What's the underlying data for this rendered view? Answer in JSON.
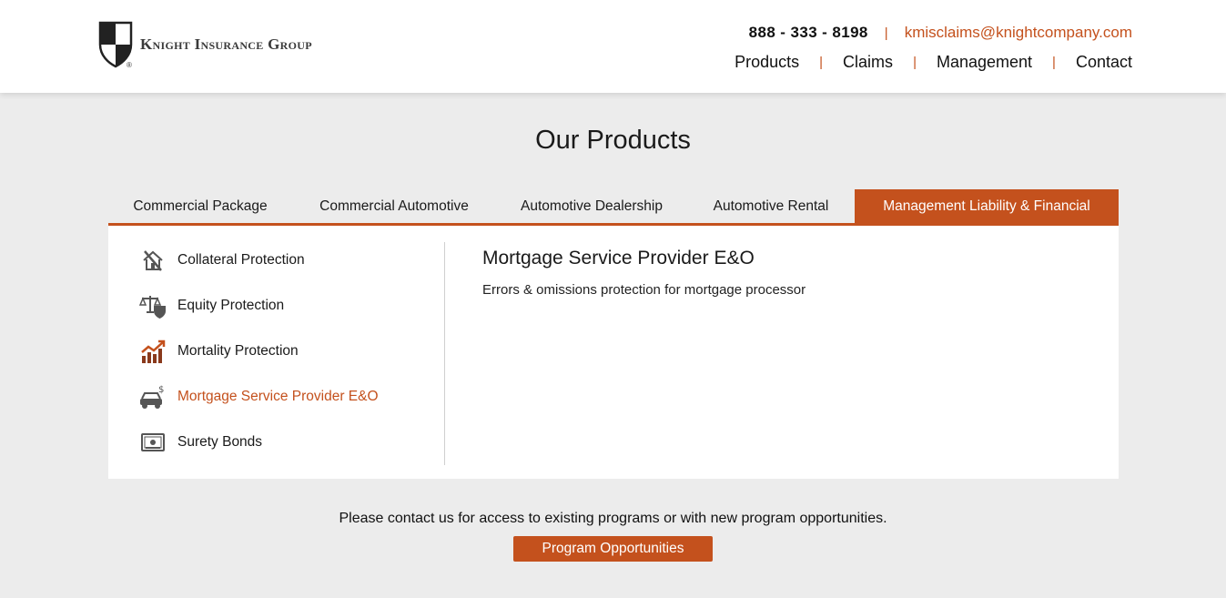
{
  "header": {
    "logo_text": "Knight Insurance Group",
    "phone": "888 - 333 - 8198",
    "email": "kmisclaims@knightcompany.com",
    "nav": [
      "Products",
      "Claims",
      "Management",
      "Contact"
    ]
  },
  "page_title": "Our Products",
  "tabs": [
    "Commercial Package",
    "Commercial Automotive",
    "Automotive Dealership",
    "Automotive Rental",
    "Management Liability & Financial"
  ],
  "active_tab": "Management Liability & Financial",
  "products": [
    {
      "label": "Collateral Protection",
      "icon": "house-broken-icon"
    },
    {
      "label": "Equity Protection",
      "icon": "scales-shield-icon"
    },
    {
      "label": "Mortality Protection",
      "icon": "rising-chart-icon"
    },
    {
      "label": "Mortgage Service Provider E&O",
      "icon": "car-dollar-icon"
    },
    {
      "label": "Surety Bonds",
      "icon": "bond-certificate-icon"
    }
  ],
  "active_product": "Mortgage Service Provider E&O",
  "detail": {
    "title": "Mortgage Service Provider E&O",
    "description": "Errors & omissions protection for mortgage processor"
  },
  "footer": {
    "text": "Please contact us for access to existing programs or with new program opportunities.",
    "button_label": "Program Opportunities"
  },
  "colors": {
    "accent": "#c4511d",
    "background": "#ececec",
    "panel": "#ffffff"
  }
}
